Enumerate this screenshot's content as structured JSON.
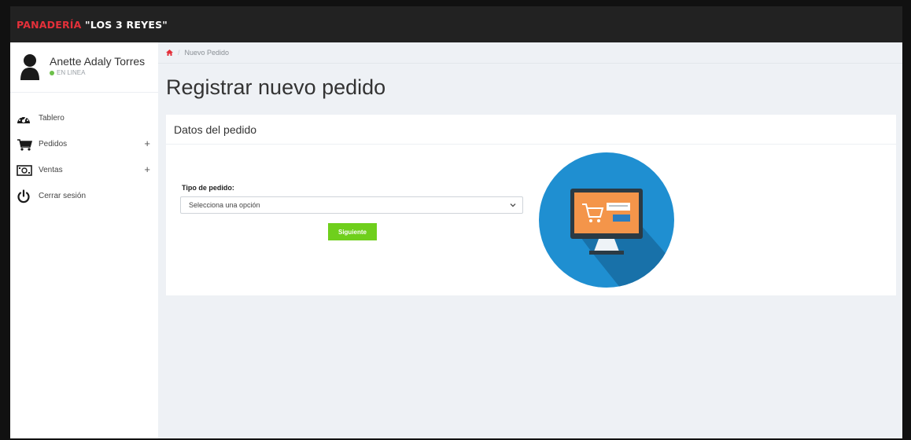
{
  "app": {
    "brand_red": "PANADERÍA ",
    "brand_white": "\"LOS 3 REYES\""
  },
  "sidebar": {
    "user_name": "Anette Adaly Torres",
    "user_status": "EN LINEA",
    "items": [
      {
        "label": "Tablero",
        "icon": "dashboard-icon",
        "expandable": false
      },
      {
        "label": "Pedidos",
        "icon": "cart-icon",
        "expandable": true
      },
      {
        "label": "Ventas",
        "icon": "money-icon",
        "expandable": true
      },
      {
        "label": "Cerrar sesión",
        "icon": "power-icon",
        "expandable": false
      }
    ],
    "expand_symbol": "+"
  },
  "breadcrumb": {
    "sep": "/",
    "current": "Nuevo Pedido"
  },
  "page": {
    "title": "Registrar nuevo pedido"
  },
  "panel": {
    "title": "Datos del pedido",
    "field_label": "Tipo de pedido:",
    "select_value": "Selecciona una opción",
    "button_label": "Siguiente"
  },
  "colors": {
    "accent_red": "#e4303a",
    "topbar": "#222222",
    "button_green": "#6fcf1c",
    "status_green": "#6cc04a",
    "illustration_blue": "#1f8fd1"
  }
}
